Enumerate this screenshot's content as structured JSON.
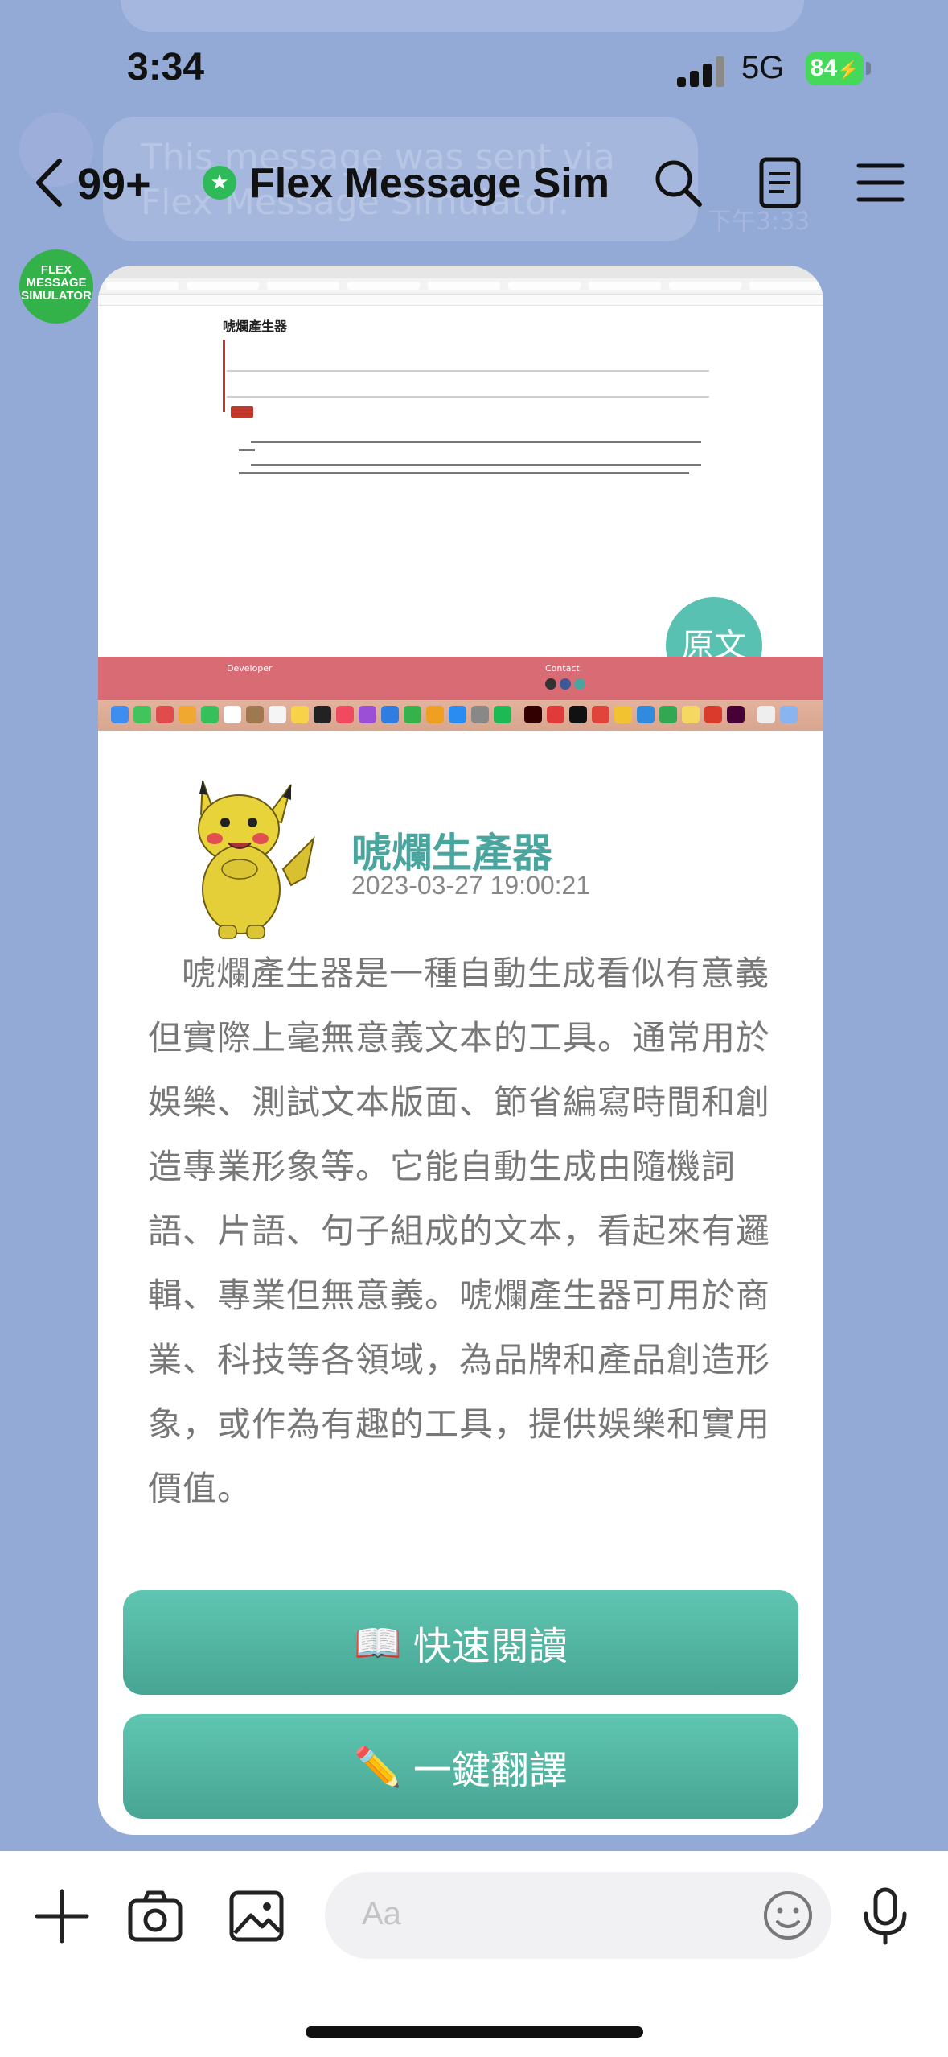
{
  "status_bar": {
    "time": "3:34",
    "network": "5G",
    "battery": "84"
  },
  "background_message": {
    "text": "This message was sent via Flex Message Simulator.",
    "time": "下午3:33"
  },
  "header": {
    "back_count": "99+",
    "title": "Flex Message Sim",
    "icons": [
      "search-icon",
      "notes-icon",
      "menu-icon"
    ]
  },
  "sender": {
    "avatar_text": [
      "FLEX",
      "MESSAGE",
      "SIMULATOR"
    ]
  },
  "card": {
    "hero": {
      "page_heading": "唬爛產生器",
      "original_badge": "原文",
      "footer_developer": "Developer",
      "footer_contact": "Contact"
    },
    "title": "唬爛生產器",
    "date": "2023-03-27 19:00:21",
    "description": "唬爛產生器是一種自動生成看似有意義但實際上毫無意義文本的工具。通常用於娛樂、測試文本版面、節省編寫時間和創造專業形象等。它能自動生成由隨機詞語、片語、句子組成的文本，看起來有邏輯、專業但無意義。唬爛產生器可用於商業、科技等各領域，為品牌和產品創造形象，或作為有趣的工具，提供娛樂和實用價值。",
    "buttons": [
      {
        "icon": "📖",
        "label": "快速閱讀"
      },
      {
        "icon": "✏️",
        "label": "一鍵翻譯"
      }
    ]
  },
  "input": {
    "placeholder": "Aa"
  },
  "colors": {
    "background": "#93a9d6",
    "accent_teal": "#4aa59e",
    "button_teal": "#52b3a0",
    "hero_footer": "#d96b74",
    "verified_green": "#2fba5a"
  }
}
